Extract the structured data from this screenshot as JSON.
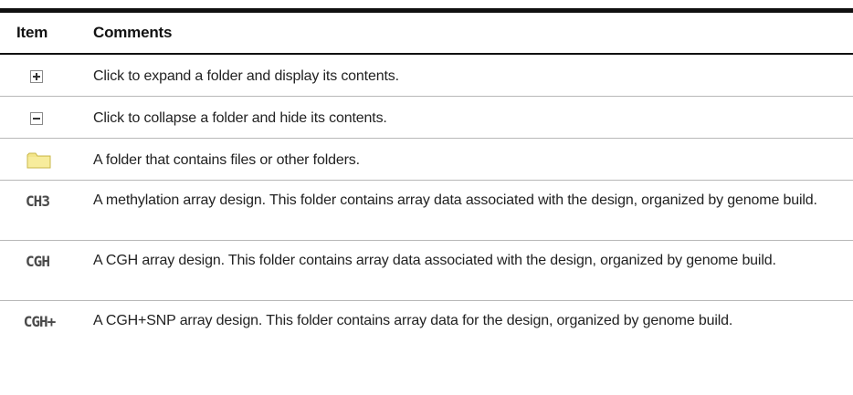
{
  "table": {
    "headers": {
      "item": "Item",
      "comments": "Comments"
    },
    "rows": [
      {
        "icon": "expand-plus-icon",
        "comment": "Click to expand a folder and display its contents."
      },
      {
        "icon": "collapse-minus-icon",
        "comment": "Click to collapse a folder and hide its contents."
      },
      {
        "icon": "folder-icon",
        "comment": "A folder that contains files or other folders."
      },
      {
        "icon": "methylation-design-icon",
        "icon_text": "CH3",
        "comment": "A methylation array design. This folder contains array data associated with the design, organized by genome build."
      },
      {
        "icon": "cgh-design-icon",
        "icon_text": "CGH",
        "comment": "A CGH array design. This folder contains array data associated with the design, organized by genome build."
      },
      {
        "icon": "cgh-snp-design-icon",
        "icon_text": "CGH+",
        "comment": "A CGH+SNP array design. This folder contains array data for the design, organized by genome build."
      }
    ]
  },
  "colors": {
    "rule_dark": "#111111",
    "rule_light": "#b8b8b8",
    "folder_fill": "#f3e58a",
    "icon_gray": "#4a4a4a"
  }
}
